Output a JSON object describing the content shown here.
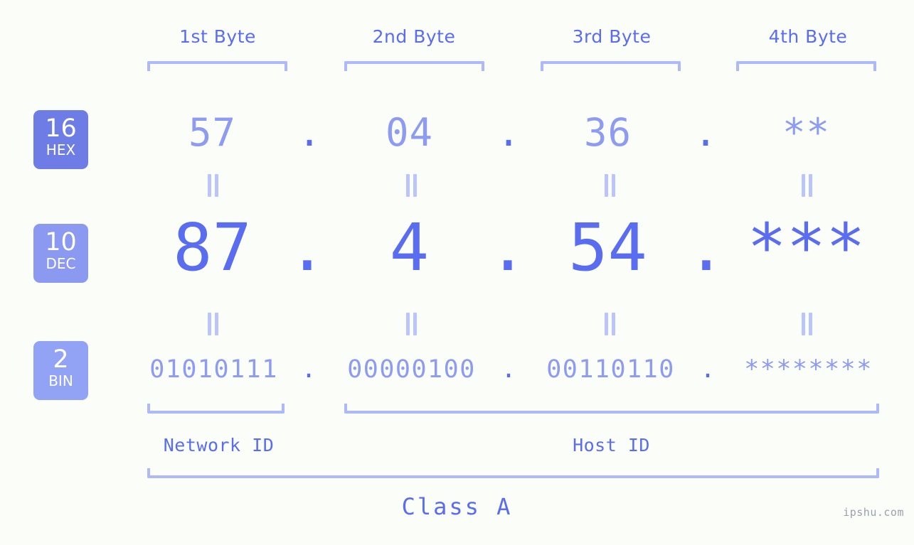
{
  "meta": {
    "background_color": "#fbfdf8",
    "accent_color": "#5a6cf0",
    "accent_light_color": "#8d9bf2",
    "bracket_color": "#aeb9fb",
    "watermark": "ipshu.com"
  },
  "byte_headers": [
    {
      "label": "1st Byte"
    },
    {
      "label": "2nd Byte"
    },
    {
      "label": "3rd Byte"
    },
    {
      "label": "4th Byte"
    }
  ],
  "rows": [
    {
      "key": "hex",
      "badge_number": "16",
      "badge_name": "HEX",
      "badge_color": "#6e7ce6",
      "values": [
        "57",
        "04",
        "36",
        "**"
      ],
      "separator": "."
    },
    {
      "key": "dec",
      "badge_number": "10",
      "badge_name": "DEC",
      "badge_color": "#8b99f0",
      "values": [
        "87",
        "4",
        "54",
        "***"
      ],
      "separator": "."
    },
    {
      "key": "bin",
      "badge_number": "2",
      "badge_name": "BIN",
      "badge_color": "#92a3f5",
      "values": [
        "01010111",
        "00000100",
        "00110110",
        "********"
      ],
      "separator": "."
    }
  ],
  "connectors": {
    "glyph": "=",
    "count_per_row_gap": 4
  },
  "id_sections": [
    {
      "label": "Network ID"
    },
    {
      "label": "Host ID"
    }
  ],
  "class_label": "Class A"
}
